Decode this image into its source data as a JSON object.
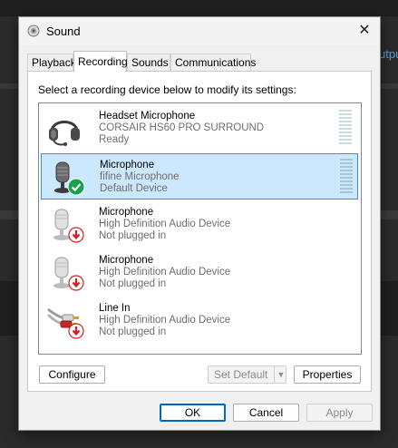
{
  "background": {
    "partial_text": "utpu"
  },
  "window": {
    "title": "Sound",
    "close_label": "✕"
  },
  "tabs": [
    {
      "label": "Playback"
    },
    {
      "label": "Recording"
    },
    {
      "label": "Sounds"
    },
    {
      "label": "Communications"
    }
  ],
  "active_tab": "Recording",
  "instruction": "Select a recording device below to modify its settings:",
  "devices": [
    {
      "name": "Headset Microphone",
      "device": "CORSAIR HS60 PRO SURROUND",
      "status": "Ready",
      "icon": "headset-icon",
      "badge": "none",
      "selected": false
    },
    {
      "name": "Microphone",
      "device": "fifine Microphone",
      "status": "Default Device",
      "icon": "microphone-icon",
      "badge": "default-check",
      "selected": true
    },
    {
      "name": "Microphone",
      "device": "High Definition Audio Device",
      "status": "Not plugged in",
      "icon": "microphone-icon",
      "badge": "unplugged-arrow",
      "selected": false
    },
    {
      "name": "Microphone",
      "device": "High Definition Audio Device",
      "status": "Not plugged in",
      "icon": "microphone-icon",
      "badge": "unplugged-arrow",
      "selected": false
    },
    {
      "name": "Line In",
      "device": "High Definition Audio Device",
      "status": "Not plugged in",
      "icon": "rca-cable-icon",
      "badge": "unplugged-arrow",
      "selected": false
    }
  ],
  "buttons": {
    "configure": "Configure",
    "set_default": "Set Default",
    "properties": "Properties",
    "ok": "OK",
    "cancel": "Cancel",
    "apply": "Apply"
  },
  "colors": {
    "selection_bg": "#cce8ff",
    "selection_border": "#3a8de0",
    "check_green": "#16a34a",
    "unplugged_red": "#d42020"
  }
}
